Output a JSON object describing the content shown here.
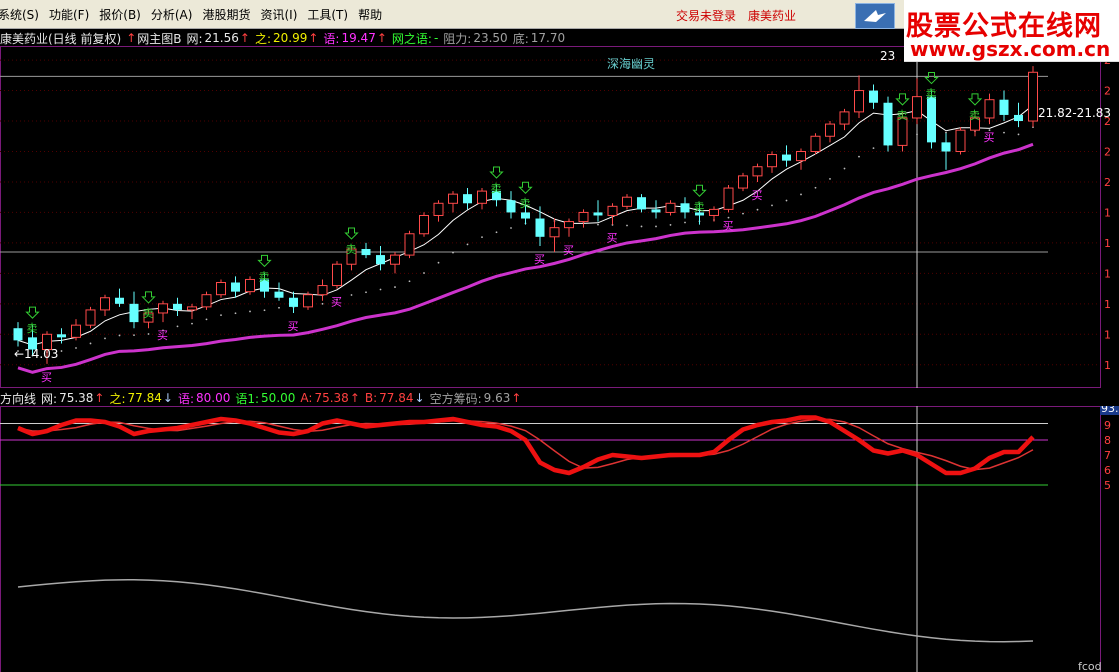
{
  "menu": {
    "items": [
      "系统(S)",
      "功能(F)",
      "报价(B)",
      "分析(A)",
      "港股期货",
      "资讯(I)",
      "工具(T)",
      "帮助"
    ],
    "status_login": "交易未登录",
    "status_stock": "康美药业"
  },
  "logo": {
    "title": "股票公式在线网",
    "url": "www.gszx.com.cn"
  },
  "main_info": {
    "stock": "康美药业(日线 前复权)",
    "indicator": "网主图B",
    "wang_label": "网:",
    "wang_value": "21.56",
    "zhi_label": "之:",
    "zhi_value": "20.99",
    "yu_label": "语:",
    "yu_value": "19.47",
    "wzy_label": "网之语:",
    "wzy_value": "-",
    "resist_label": "阻力:",
    "resist_value": "23.50",
    "bottom_label": "底:",
    "bottom_value": "17.70"
  },
  "main_chart": {
    "annotation_top": "深海幽灵",
    "high_label": "23",
    "low_label": "←14.03",
    "last_range": "21.82-21.83",
    "buy_label": "买",
    "sell_label": "卖"
  },
  "sub_info": {
    "indicator": "方向线",
    "wang_label": "网:",
    "wang_value": "75.38",
    "zhi_label": "之:",
    "zhi_value": "77.84",
    "yu_label": "语:",
    "yu_value": "80.00",
    "yu1_label": "语1:",
    "yu1_value": "50.00",
    "a_label": "A:",
    "a_value": "75.38",
    "b_label": "B:",
    "b_value": "77.84",
    "kong_label": "空方筹码:",
    "kong_value": "9.63"
  },
  "sub_chart": {
    "right_label": "93.",
    "bottom_label": "fcod"
  },
  "colors": {
    "up": "#ff4a4a",
    "down": "#66ffff",
    "ma_long": "#cc33cc",
    "ma_short": "#ffffff",
    "osc_thick": "#ee1111",
    "osc_thin": "#dd3333",
    "grey_line": "#a8a8a8",
    "buy_sign": "#ff33ff",
    "sell_sign": "#33cc33"
  },
  "chart_data": {
    "type": "candlestick",
    "candles": [
      {
        "o": 15.2,
        "h": 15.4,
        "l": 14.6,
        "c": 14.8
      },
      {
        "o": 14.9,
        "h": 15.3,
        "l": 14.3,
        "c": 14.5
      },
      {
        "o": 14.5,
        "h": 15.1,
        "l": 14.03,
        "c": 15.0
      },
      {
        "o": 15.0,
        "h": 15.2,
        "l": 14.7,
        "c": 14.9
      },
      {
        "o": 14.9,
        "h": 15.5,
        "l": 14.8,
        "c": 15.3
      },
      {
        "o": 15.3,
        "h": 15.9,
        "l": 15.2,
        "c": 15.8
      },
      {
        "o": 15.8,
        "h": 16.3,
        "l": 15.6,
        "c": 16.2
      },
      {
        "o": 16.2,
        "h": 16.5,
        "l": 15.9,
        "c": 16.0
      },
      {
        "o": 16.0,
        "h": 16.4,
        "l": 15.2,
        "c": 15.4
      },
      {
        "o": 15.4,
        "h": 15.8,
        "l": 15.2,
        "c": 15.7
      },
      {
        "o": 15.7,
        "h": 16.1,
        "l": 15.4,
        "c": 16.0
      },
      {
        "o": 16.0,
        "h": 16.2,
        "l": 15.6,
        "c": 15.8
      },
      {
        "o": 15.8,
        "h": 16.0,
        "l": 15.5,
        "c": 15.9
      },
      {
        "o": 15.9,
        "h": 16.4,
        "l": 15.8,
        "c": 16.3
      },
      {
        "o": 16.3,
        "h": 16.8,
        "l": 16.2,
        "c": 16.7
      },
      {
        "o": 16.7,
        "h": 16.9,
        "l": 16.2,
        "c": 16.4
      },
      {
        "o": 16.4,
        "h": 16.9,
        "l": 16.3,
        "c": 16.8
      },
      {
        "o": 16.8,
        "h": 17.0,
        "l": 16.2,
        "c": 16.4
      },
      {
        "o": 16.4,
        "h": 16.7,
        "l": 16.1,
        "c": 16.2
      },
      {
        "o": 16.2,
        "h": 16.4,
        "l": 15.7,
        "c": 15.9
      },
      {
        "o": 15.9,
        "h": 16.4,
        "l": 15.8,
        "c": 16.3
      },
      {
        "o": 16.3,
        "h": 16.8,
        "l": 16.1,
        "c": 16.6
      },
      {
        "o": 16.6,
        "h": 17.4,
        "l": 16.5,
        "c": 17.3
      },
      {
        "o": 17.3,
        "h": 17.9,
        "l": 17.1,
        "c": 17.8
      },
      {
        "o": 17.8,
        "h": 18.0,
        "l": 17.5,
        "c": 17.6
      },
      {
        "o": 17.6,
        "h": 17.9,
        "l": 17.1,
        "c": 17.3
      },
      {
        "o": 17.3,
        "h": 17.7,
        "l": 17.0,
        "c": 17.6
      },
      {
        "o": 17.6,
        "h": 18.4,
        "l": 17.5,
        "c": 18.3
      },
      {
        "o": 18.3,
        "h": 19.0,
        "l": 18.2,
        "c": 18.9
      },
      {
        "o": 18.9,
        "h": 19.4,
        "l": 18.7,
        "c": 19.3
      },
      {
        "o": 19.3,
        "h": 19.7,
        "l": 19.0,
        "c": 19.6
      },
      {
        "o": 19.6,
        "h": 19.8,
        "l": 19.1,
        "c": 19.3
      },
      {
        "o": 19.3,
        "h": 19.8,
        "l": 19.1,
        "c": 19.7
      },
      {
        "o": 19.7,
        "h": 19.9,
        "l": 19.2,
        "c": 19.4
      },
      {
        "o": 19.4,
        "h": 19.7,
        "l": 18.8,
        "c": 19.0
      },
      {
        "o": 19.0,
        "h": 19.4,
        "l": 18.6,
        "c": 18.8
      },
      {
        "o": 18.8,
        "h": 19.2,
        "l": 17.9,
        "c": 18.2
      },
      {
        "o": 18.2,
        "h": 18.8,
        "l": 17.7,
        "c": 18.5
      },
      {
        "o": 18.5,
        "h": 18.8,
        "l": 18.2,
        "c": 18.7
      },
      {
        "o": 18.7,
        "h": 19.1,
        "l": 18.5,
        "c": 19.0
      },
      {
        "o": 19.0,
        "h": 19.4,
        "l": 18.7,
        "c": 18.9
      },
      {
        "o": 18.9,
        "h": 19.3,
        "l": 18.6,
        "c": 19.2
      },
      {
        "o": 19.2,
        "h": 19.6,
        "l": 19.1,
        "c": 19.5
      },
      {
        "o": 19.5,
        "h": 19.6,
        "l": 19.0,
        "c": 19.1
      },
      {
        "o": 19.1,
        "h": 19.4,
        "l": 18.8,
        "c": 19.0
      },
      {
        "o": 19.0,
        "h": 19.4,
        "l": 18.9,
        "c": 19.3
      },
      {
        "o": 19.3,
        "h": 19.5,
        "l": 18.8,
        "c": 19.0
      },
      {
        "o": 19.0,
        "h": 19.3,
        "l": 18.6,
        "c": 18.9
      },
      {
        "o": 18.9,
        "h": 19.2,
        "l": 18.7,
        "c": 19.1
      },
      {
        "o": 19.1,
        "h": 19.9,
        "l": 19.0,
        "c": 19.8
      },
      {
        "o": 19.8,
        "h": 20.3,
        "l": 19.7,
        "c": 20.2
      },
      {
        "o": 20.2,
        "h": 20.6,
        "l": 20.0,
        "c": 20.5
      },
      {
        "o": 20.5,
        "h": 21.0,
        "l": 20.3,
        "c": 20.9
      },
      {
        "o": 20.9,
        "h": 21.2,
        "l": 20.5,
        "c": 20.7
      },
      {
        "o": 20.7,
        "h": 21.1,
        "l": 20.4,
        "c": 21.0
      },
      {
        "o": 21.0,
        "h": 21.6,
        "l": 20.9,
        "c": 21.5
      },
      {
        "o": 21.5,
        "h": 22.0,
        "l": 21.3,
        "c": 21.9
      },
      {
        "o": 21.9,
        "h": 22.4,
        "l": 21.7,
        "c": 22.3
      },
      {
        "o": 22.3,
        "h": 23.5,
        "l": 22.1,
        "c": 23.0
      },
      {
        "o": 23.0,
        "h": 23.2,
        "l": 22.4,
        "c": 22.6
      },
      {
        "o": 22.6,
        "h": 22.8,
        "l": 21.0,
        "c": 21.2
      },
      {
        "o": 21.2,
        "h": 22.3,
        "l": 21.0,
        "c": 22.1
      },
      {
        "o": 22.1,
        "h": 23.4,
        "l": 21.9,
        "c": 22.8
      },
      {
        "o": 22.8,
        "h": 23.0,
        "l": 21.1,
        "c": 21.3
      },
      {
        "o": 21.3,
        "h": 21.6,
        "l": 20.4,
        "c": 21.0
      },
      {
        "o": 21.0,
        "h": 21.8,
        "l": 20.9,
        "c": 21.7
      },
      {
        "o": 21.7,
        "h": 22.3,
        "l": 21.5,
        "c": 22.1
      },
      {
        "o": 22.1,
        "h": 22.9,
        "l": 21.9,
        "c": 22.7
      },
      {
        "o": 22.7,
        "h": 23.0,
        "l": 22.0,
        "c": 22.2
      },
      {
        "o": 22.2,
        "h": 22.6,
        "l": 21.8,
        "c": 22.0
      },
      {
        "o": 22.0,
        "h": 23.8,
        "l": 21.8,
        "c": 23.6
      }
    ],
    "ylim": [
      13.5,
      24.2
    ],
    "osc_ylim": [
      0,
      100
    ],
    "osc_levels": [
      95,
      80,
      50
    ]
  }
}
